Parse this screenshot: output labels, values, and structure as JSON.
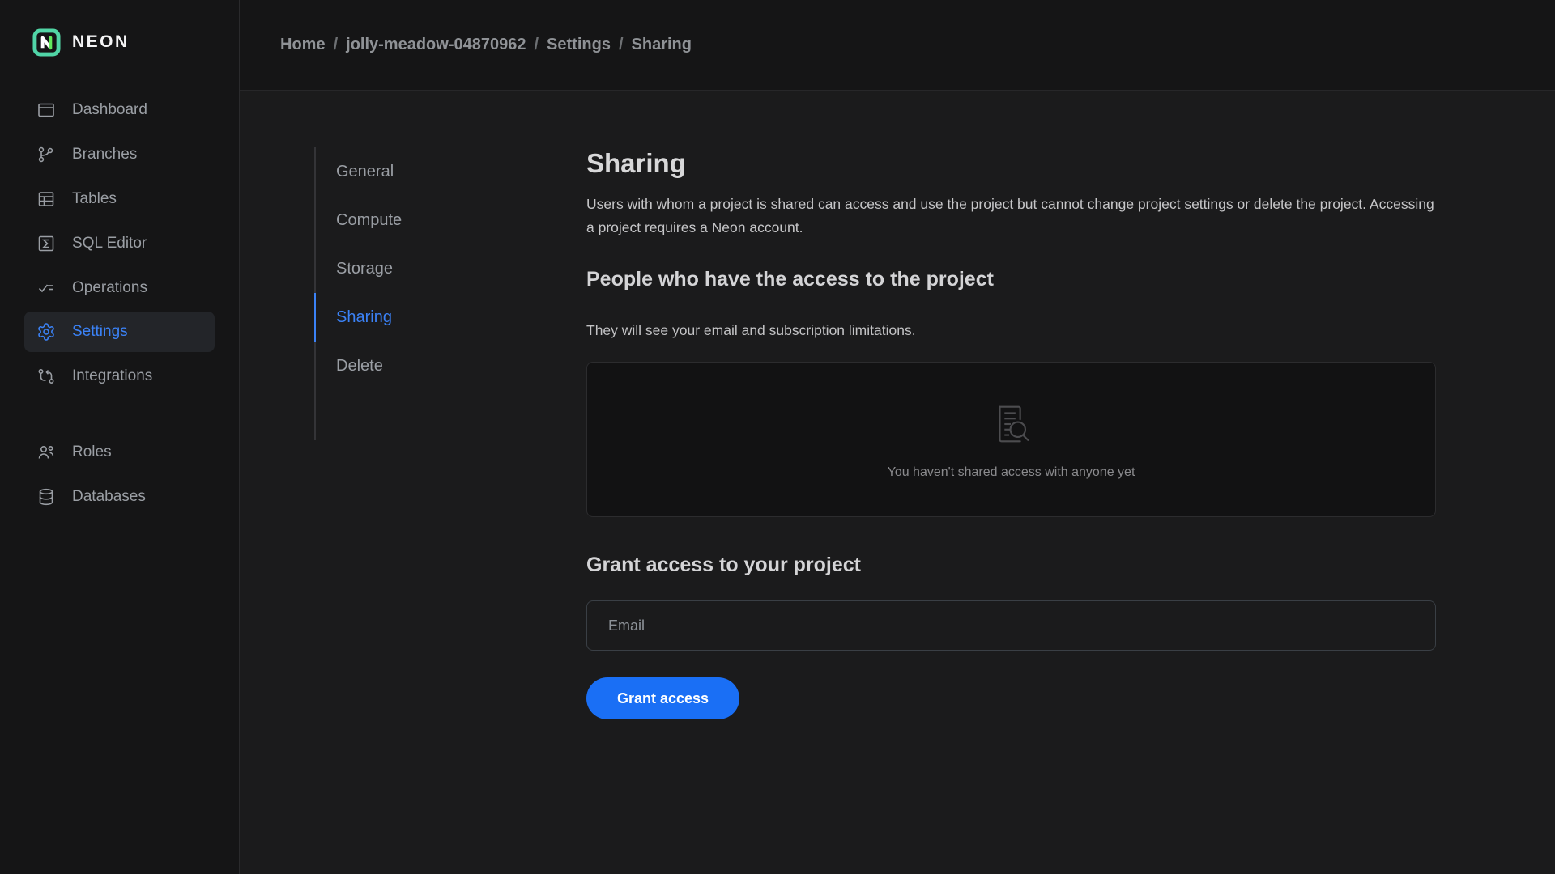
{
  "brand": {
    "name": "NEON"
  },
  "sidebar": {
    "items": [
      {
        "label": "Dashboard",
        "icon": "dashboard-icon",
        "active": false
      },
      {
        "label": "Branches",
        "icon": "branches-icon",
        "active": false
      },
      {
        "label": "Tables",
        "icon": "tables-icon",
        "active": false
      },
      {
        "label": "SQL Editor",
        "icon": "sql-editor-icon",
        "active": false
      },
      {
        "label": "Operations",
        "icon": "operations-icon",
        "active": false
      },
      {
        "label": "Settings",
        "icon": "settings-gear-icon",
        "active": true
      },
      {
        "label": "Integrations",
        "icon": "integrations-icon",
        "active": false
      }
    ],
    "secondary_items": [
      {
        "label": "Roles",
        "icon": "roles-users-icon"
      },
      {
        "label": "Databases",
        "icon": "databases-icon"
      }
    ]
  },
  "breadcrumb": {
    "separator": "/",
    "items": [
      "Home",
      "jolly-meadow-04870962",
      "Settings",
      "Sharing"
    ]
  },
  "subnav": {
    "active": "Sharing",
    "items": [
      "General",
      "Compute",
      "Storage",
      "Sharing",
      "Delete"
    ]
  },
  "main": {
    "title": "Sharing",
    "description": "Users with whom a project is shared can access and use the project but cannot change project settings or delete the project. Accessing a project requires a Neon account.",
    "people_section": {
      "heading": "People who have the access to the project",
      "subtext": "They will see your email and subscription limitations.",
      "empty_state_text": "You haven't shared access with anyone yet",
      "empty_state_icon": "document-search-icon"
    },
    "grant_section": {
      "heading": "Grant access to your project",
      "email_placeholder": "Email",
      "button_label": "Grant access"
    }
  },
  "colors": {
    "accent_blue": "#3b82f6",
    "button_blue": "#1a6ff5",
    "brand_gradient_start": "#3fc1f0",
    "brand_gradient_end": "#62e95c",
    "sidebar_bg": "#151516",
    "content_bg": "#1b1b1c",
    "panel_bg": "#121213"
  }
}
